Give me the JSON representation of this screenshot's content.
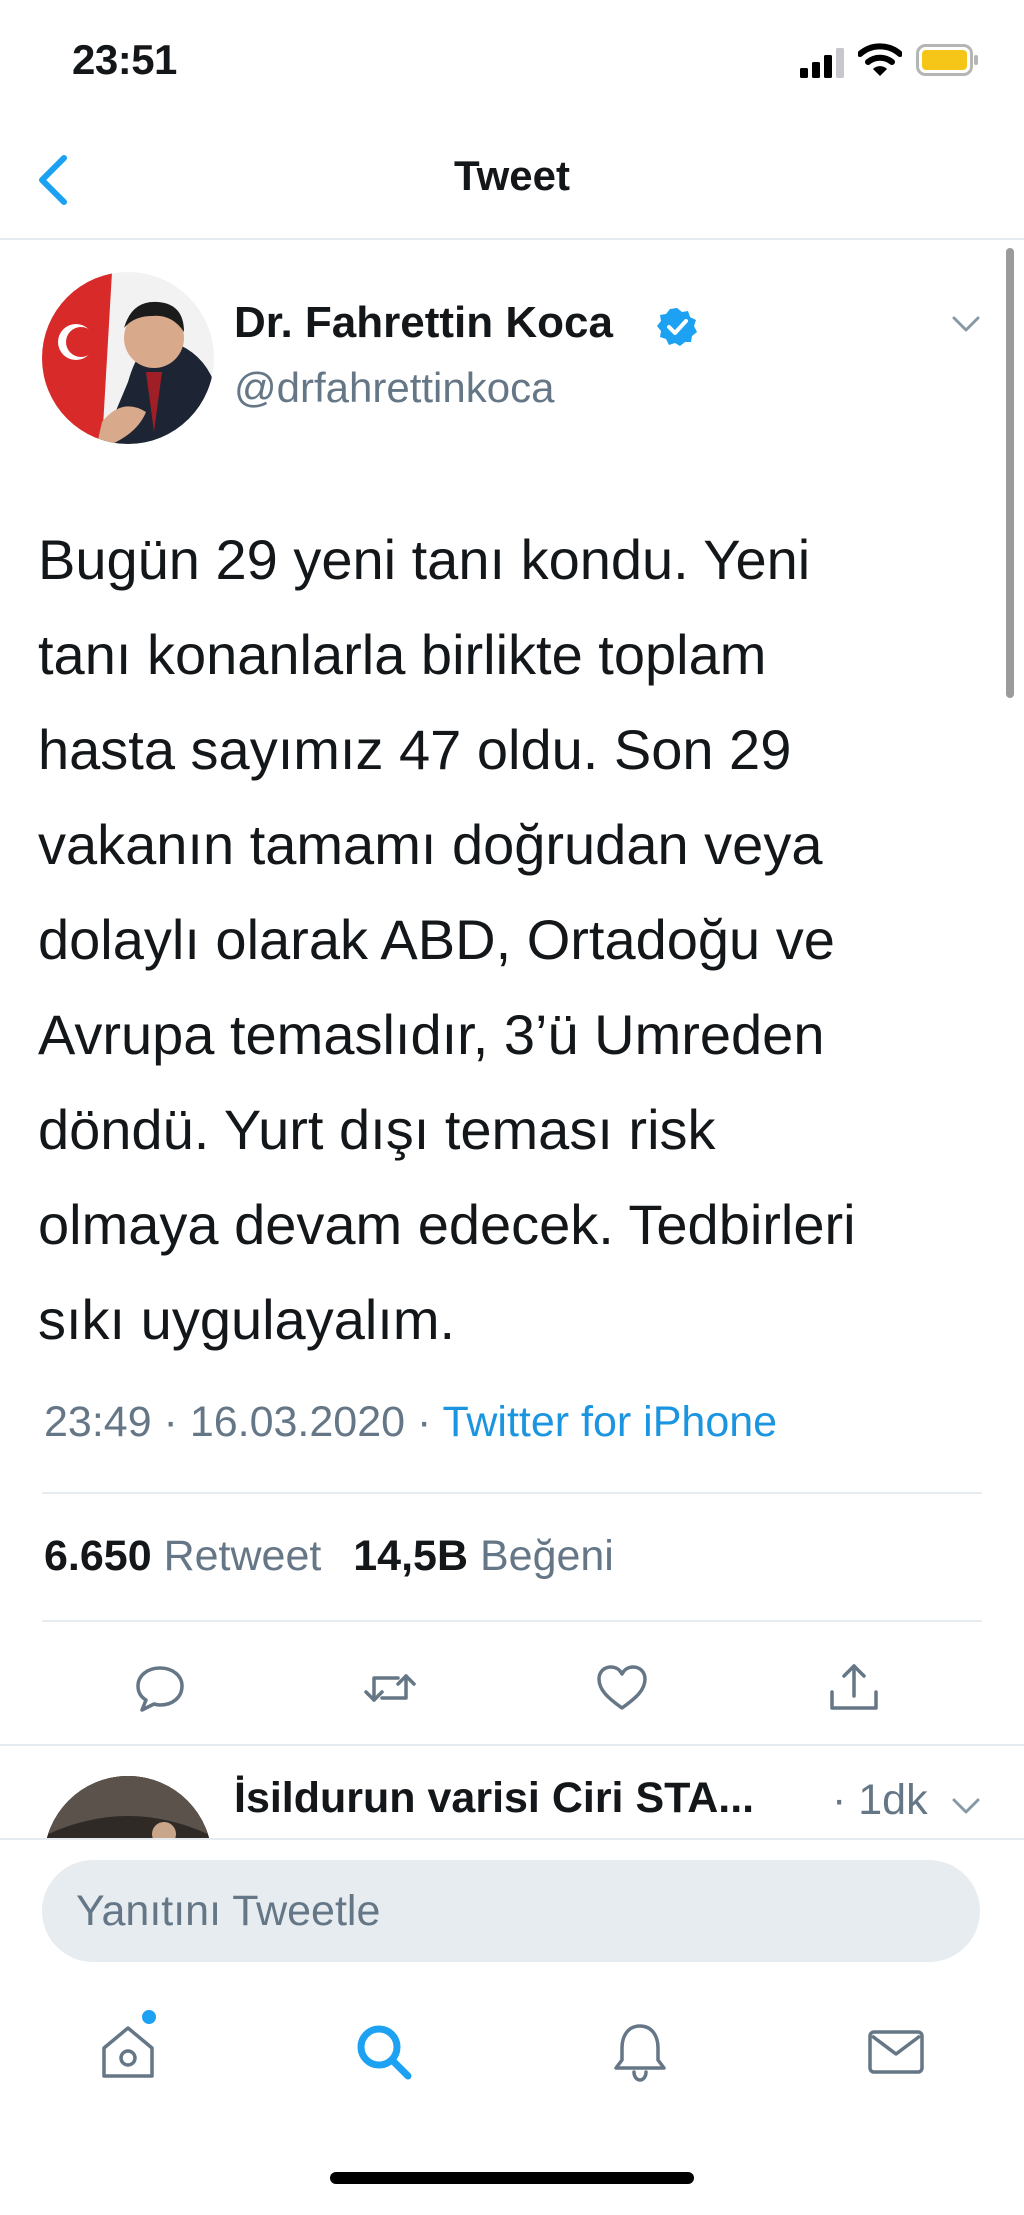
{
  "status_bar": {
    "time": "23:51"
  },
  "nav": {
    "title": "Tweet"
  },
  "tweet": {
    "author": {
      "display_name": "Dr. Fahrettin Koca",
      "username": "@drfahrettinkoca",
      "verified": true
    },
    "text_lines": [
      "Bugün 29 yeni tanı kondu. Yeni",
      "tanı konanlarla birlikte toplam",
      "hasta sayımız 47 oldu. Son 29",
      "vakanın tamamı doğrudan veya",
      "dolaylı olarak ABD, Ortadoğu ve",
      "Avrupa temaslıdır, 3’ü Umreden",
      "döndü. Yurt dışı teması risk",
      "olmaya devam edecek. Tedbirleri",
      "sıkı uygulayalım."
    ],
    "time": "23:49",
    "date": "16.03.2020",
    "separator": " · ",
    "source": "Twitter for iPhone",
    "stats": {
      "retweets_count": "6.650",
      "retweets_label": "Retweet",
      "likes_count": "14,5B",
      "likes_label": "Beğeni"
    }
  },
  "actions": [
    "reply-icon",
    "retweet-icon",
    "like-icon",
    "share-icon"
  ],
  "reply_preview": {
    "name": "İsildurun varisi Ciri STA...",
    "time": "· 1dk"
  },
  "reply_input": {
    "placeholder": "Yanıtını Tweetle"
  },
  "tab_bar": [
    "home-icon",
    "search-icon",
    "notifications-icon",
    "messages-icon"
  ],
  "colors": {
    "accent": "#1da1f2",
    "link": "#1b95e0",
    "secondary_text": "#657786",
    "divider": "#e6ecf0",
    "battery": "#f5c518"
  }
}
